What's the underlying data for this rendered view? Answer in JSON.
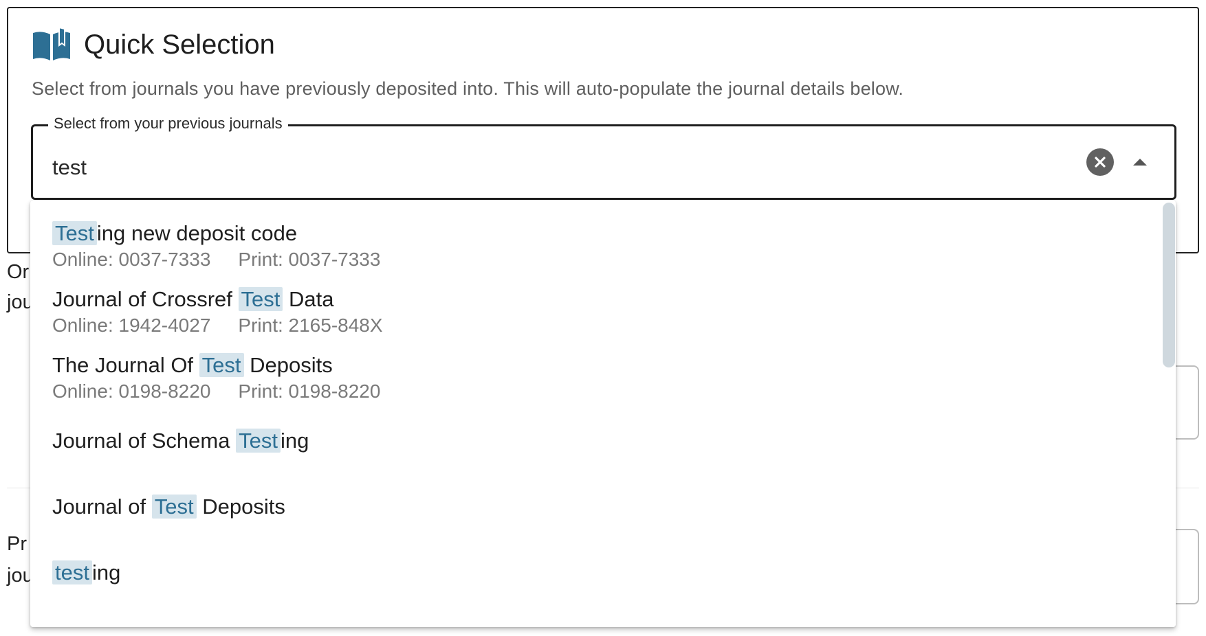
{
  "quick_selection": {
    "title": "Quick Selection",
    "description": "Select from journals you have previously deposited into. This will auto-populate the journal details below.",
    "icon": "book-open-icon",
    "accent_color": "#2d6f94"
  },
  "journal_select": {
    "label": "Select from your previous journals",
    "value": "test",
    "clear_icon": "clear-circle-icon",
    "toggle_icon": "caret-up-icon"
  },
  "background": {
    "line1a": "Or",
    "line1b": "jou",
    "line2a": "Pr",
    "line2b": "jou"
  },
  "options": [
    {
      "pre": "",
      "match": "Test",
      "post": "ing new deposit code",
      "online": "Online: 0037-7333",
      "print": "Print: 0037-7333"
    },
    {
      "pre": "Journal of Crossref ",
      "match": "Test",
      "post": " Data",
      "online": "Online: 1942-4027",
      "print": "Print: 2165-848X"
    },
    {
      "pre": "The Journal Of ",
      "match": "Test",
      "post": " Deposits",
      "online": "Online: 0198-8220",
      "print": "Print: 0198-8220"
    },
    {
      "pre": "Journal of Schema ",
      "match": "Test",
      "post": "ing"
    },
    {
      "pre": "Journal of ",
      "match": "Test",
      "post": " Deposits"
    },
    {
      "pre": "",
      "match": "test",
      "post": "ing"
    }
  ],
  "colors": {
    "highlight_bg": "#d6e4ec",
    "highlight_text": "#2d6f94",
    "scroll_thumb": "#cfd8de"
  }
}
